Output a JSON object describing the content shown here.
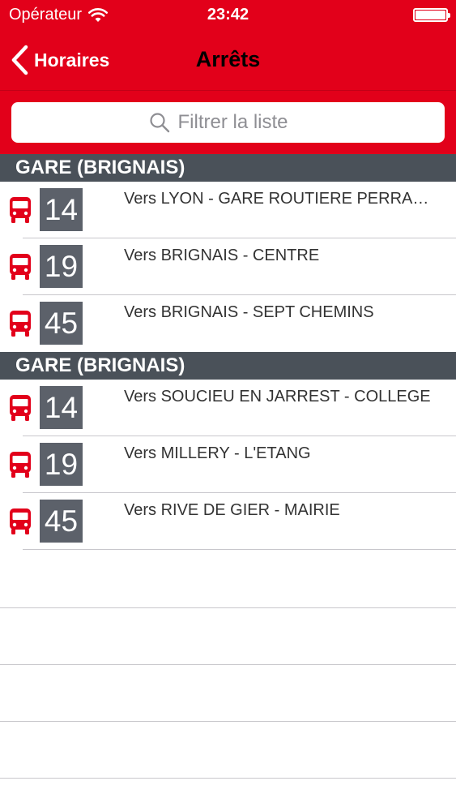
{
  "status_bar": {
    "carrier": "Opérateur",
    "time": "23:42"
  },
  "nav": {
    "back_label": "Horaires",
    "title": "Arrêts"
  },
  "search": {
    "placeholder": "Filtrer la liste"
  },
  "sections": [
    {
      "title": "GARE (BRIGNAIS)",
      "rows": [
        {
          "line": "14",
          "direction": "Vers LYON - GARE ROUTIERE PERRACHE"
        },
        {
          "line": "19",
          "direction": "Vers BRIGNAIS - CENTRE"
        },
        {
          "line": "45",
          "direction": "Vers BRIGNAIS - SEPT CHEMINS"
        }
      ]
    },
    {
      "title": "GARE (BRIGNAIS)",
      "rows": [
        {
          "line": "14",
          "direction": "Vers SOUCIEU EN JARREST - COLLEGE"
        },
        {
          "line": "19",
          "direction": "Vers MILLERY - L'ETANG"
        },
        {
          "line": "45",
          "direction": "Vers RIVE DE GIER - MAIRIE"
        }
      ]
    }
  ],
  "colors": {
    "accent": "#e2001a",
    "section_bg": "#4a5159",
    "badge_bg": "#5c616a",
    "bus_icon": "#e2001a"
  },
  "icons": {
    "back": "chevron-left-icon",
    "search": "search-icon",
    "wifi": "wifi-icon",
    "bus": "bus-icon",
    "battery": "battery-icon"
  }
}
